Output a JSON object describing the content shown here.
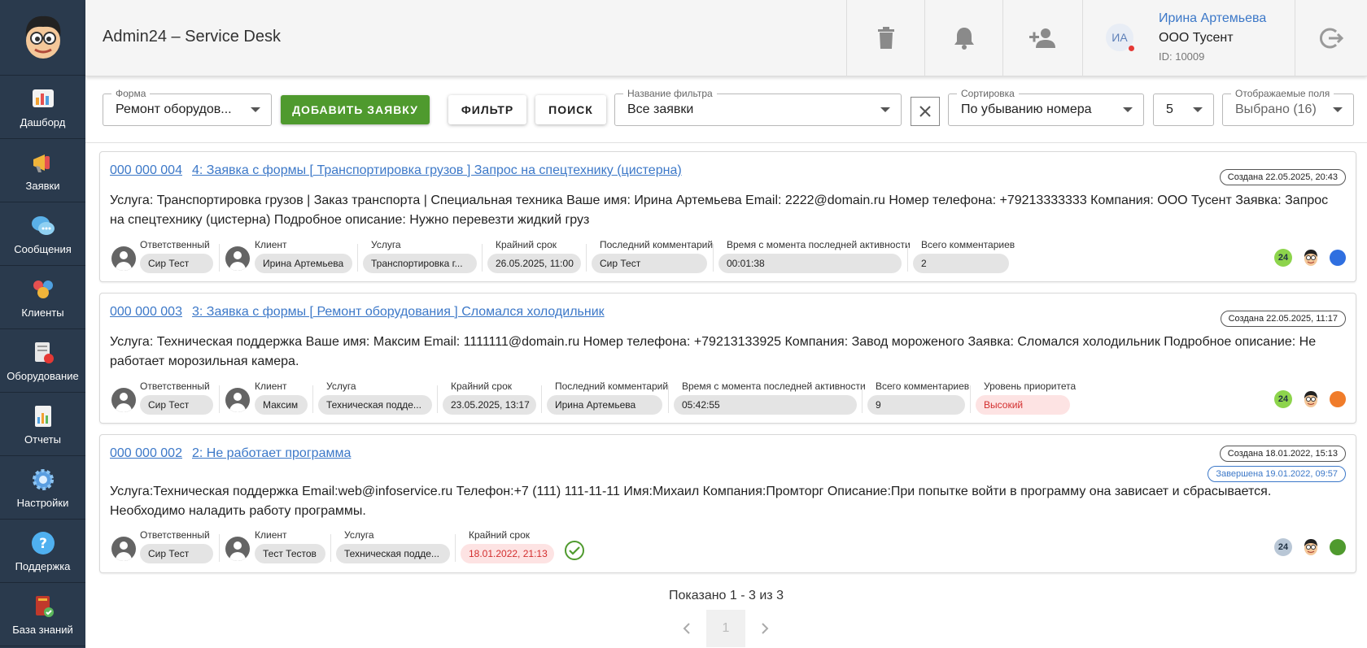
{
  "header": {
    "title": "Admin24 – Service Desk",
    "user": {
      "initials": "ИА",
      "name": "Ирина Артемьева",
      "company": "ООО Тусент",
      "id": "ID: 10009"
    }
  },
  "sidebar": {
    "items": [
      {
        "label": "Дашборд",
        "icon": "dashboard-icon"
      },
      {
        "label": "Заявки",
        "icon": "megaphone-icon"
      },
      {
        "label": "Сообщения",
        "icon": "chat-icon"
      },
      {
        "label": "Клиенты",
        "icon": "clients-icon"
      },
      {
        "label": "Оборудование",
        "icon": "equipment-icon"
      },
      {
        "label": "Отчеты",
        "icon": "reports-icon"
      },
      {
        "label": "Настройки",
        "icon": "gear-icon"
      },
      {
        "label": "Поддержка",
        "icon": "help-icon"
      },
      {
        "label": "База знаний",
        "icon": "book-icon"
      }
    ]
  },
  "toolbar": {
    "form": {
      "legend": "Форма",
      "value": "Ремонт оборудов..."
    },
    "add_label": "ДОБАВИТЬ ЗАЯВКУ",
    "filter_label": "ФИЛЬТР",
    "search_label": "ПОИСК",
    "filter_name": {
      "legend": "Название фильтра",
      "value": "Все заявки"
    },
    "sort": {
      "legend": "Сортировка",
      "value": "По убыванию номера"
    },
    "per_page": "5",
    "fields": {
      "legend": "Отображаемые поля",
      "value": "Выбрано (16)"
    }
  },
  "tickets": [
    {
      "number": "000 000 004",
      "title": "4: Заявка с формы [ Транспортировка грузов ] Запрос на спецтехнику (цистерна)",
      "created": "Создана 22.05.2025, 20:43",
      "description": "Услуга: Транспортировка грузов | Заказ транспорта | Специальная техника Ваше имя: Ирина Артемьева Email: 2222@domain.ru Номер телефона: +79213333333 Компания: ООО Тусент Заявка: Запрос на спецтехнику (цистерна) Подробное описание: Нужно перевезти жидкий груз",
      "meta": [
        {
          "label": "Ответственный",
          "value": "Сир Тест"
        },
        {
          "label": "Клиент",
          "value": "Ирина Артемьева"
        },
        {
          "label": "Услуга",
          "value": "Транспортировка г..."
        },
        {
          "label": "Крайний срок",
          "value": "26.05.2025, 11:00"
        },
        {
          "label": "Последний комментарий",
          "value": "Сир Тест"
        },
        {
          "label": "Время с момента последней активности",
          "value": "00:01:38"
        },
        {
          "label": "Всего комментариев",
          "value": "2"
        }
      ],
      "badge": "24",
      "status_color": "#2f6fe0"
    },
    {
      "number": "000 000 003",
      "title": "3: Заявка с формы [ Ремонт оборудования ] Сломался холодильник",
      "created": "Создана 22.05.2025, 11:17",
      "description": "Услуга: Техническая поддержка Ваше имя: Максим Email: 1111111@domain.ru Номер телефона: +79213133925 Компания: Завод мороженого Заявка: Сломался холодильник Подробное описание: Не работает морозильная камера.",
      "meta": [
        {
          "label": "Ответственный",
          "value": "Сир Тест"
        },
        {
          "label": "Клиент",
          "value": "Максим"
        },
        {
          "label": "Услуга",
          "value": "Техническая подде..."
        },
        {
          "label": "Крайний срок",
          "value": "23.05.2025, 13:17"
        },
        {
          "label": "Последний комментарий",
          "value": "Ирина Артемьева"
        },
        {
          "label": "Время с момента последней активности",
          "value": "05:42:55"
        },
        {
          "label": "Всего комментариев",
          "value": "9"
        },
        {
          "label": "Уровень приоритета",
          "value": "Высокий"
        }
      ],
      "badge": "24",
      "status_color": "#f07c2a"
    },
    {
      "number": "000 000 002",
      "title": "2: Не работает программа",
      "created": "Создана 18.01.2022, 15:13",
      "completed": "Завершена 19.01.2022, 09:57",
      "description": "Услуга:Техническая поддержка Email:web@infoservice.ru Телефон:+7 (111) 111-11-11 Имя:Михаил Компания:Промторг Описание:При попытке войти в программу она зависает и сбрасывается. Необходимо наладить работу программы.",
      "meta": [
        {
          "label": "Ответственный",
          "value": "Сир Тест"
        },
        {
          "label": "Клиент",
          "value": "Тест Тестов"
        },
        {
          "label": "Услуга",
          "value": "Техническая подде..."
        },
        {
          "label": "Крайний срок",
          "value": "18.01.2022, 21:13"
        }
      ],
      "badge": "24",
      "status_color": "#4f9a2e"
    }
  ],
  "pagination": {
    "summary": "Показано 1 - 3 из 3",
    "current": "1"
  }
}
